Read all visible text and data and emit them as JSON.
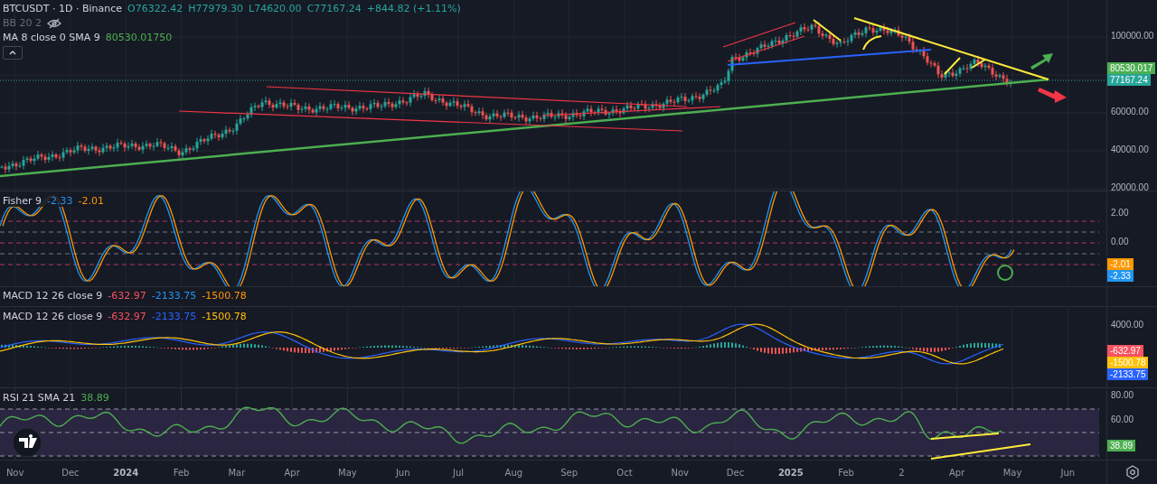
{
  "header": {
    "title": "BTCUSDT · 1D · Binance",
    "quote": [
      "O76322.42",
      "H77979.30",
      "L74620.00",
      "C77167.24",
      "+844.82 (+1.11%)"
    ]
  },
  "overlays": [
    {
      "name": "BB 20 2",
      "visible": false
    },
    {
      "name": "MA 8 close 0 SMA 9",
      "visible": true,
      "value": "80530.01750"
    }
  ],
  "panes": [
    {
      "kind": "price",
      "axis_labels": [
        "100000.00",
        "60000.00",
        "40000.00",
        "20000.00"
      ],
      "tags": [
        {
          "text": "80530.017",
          "color": "#4caf50"
        },
        {
          "text": "77167.24",
          "color": "#26a69a"
        }
      ]
    },
    {
      "kind": "fisher",
      "legend": {
        "name": "Fisher 9",
        "values": [
          {
            "text": "-2.33",
            "color": "#2196f3"
          },
          {
            "text": "-2.01",
            "color": "#ff9800"
          }
        ]
      },
      "axis_labels": [
        "2.00",
        "0.00"
      ],
      "tags": [
        {
          "text": "-2.01",
          "color": "#ff9800"
        },
        {
          "text": "-2.33",
          "color": "#2196f3"
        }
      ]
    },
    {
      "kind": "collapsed",
      "legend": {
        "name": "MACD 12 26 close 9",
        "values": [
          {
            "text": "-632.97",
            "color": "#f7525f"
          },
          {
            "text": "-2133.75",
            "color": "#2196f3"
          },
          {
            "text": "-1500.78",
            "color": "#ff9800"
          }
        ]
      }
    },
    {
      "kind": "macd",
      "legend": {
        "name": "MACD 12 26 close 9",
        "values": [
          {
            "text": "-632.97",
            "color": "#f7525f"
          },
          {
            "text": "-2133.75",
            "color": "#2962ff"
          },
          {
            "text": "-1500.78",
            "color": "#ffc107"
          }
        ]
      },
      "axis_labels": [
        "4000.00"
      ],
      "tags": [
        {
          "text": "-632.97",
          "color": "#f7525f"
        },
        {
          "text": "-1500.78",
          "color": "#ffc107"
        },
        {
          "text": "-2133.75",
          "color": "#2962ff"
        }
      ]
    },
    {
      "kind": "rsi",
      "legend": {
        "name": "RSI 21 SMA 21",
        "values": [
          {
            "text": "38.89",
            "color": "#4caf50"
          }
        ]
      },
      "axis_labels": [
        "80.00",
        "60.00"
      ],
      "tags": [
        {
          "text": "38.89",
          "color": "#4caf50"
        }
      ]
    }
  ],
  "time_axis": [
    {
      "label": "Nov",
      "kind": "month"
    },
    {
      "label": "Dec",
      "kind": "month"
    },
    {
      "label": "2024",
      "kind": "year"
    },
    {
      "label": "Feb",
      "kind": "month"
    },
    {
      "label": "Mar",
      "kind": "month"
    },
    {
      "label": "Apr",
      "kind": "month"
    },
    {
      "label": "May",
      "kind": "month"
    },
    {
      "label": "Jun",
      "kind": "month"
    },
    {
      "label": "Jul",
      "kind": "month"
    },
    {
      "label": "Aug",
      "kind": "month"
    },
    {
      "label": "Sep",
      "kind": "month"
    },
    {
      "label": "Oct",
      "kind": "month"
    },
    {
      "label": "Nov",
      "kind": "month"
    },
    {
      "label": "Dec",
      "kind": "month"
    },
    {
      "label": "2025",
      "kind": "year"
    },
    {
      "label": "Feb",
      "kind": "month"
    },
    {
      "label": "2",
      "kind": "month"
    },
    {
      "label": "Apr",
      "kind": "month"
    },
    {
      "label": "May",
      "kind": "month"
    },
    {
      "label": "Jun",
      "kind": "month"
    }
  ]
}
